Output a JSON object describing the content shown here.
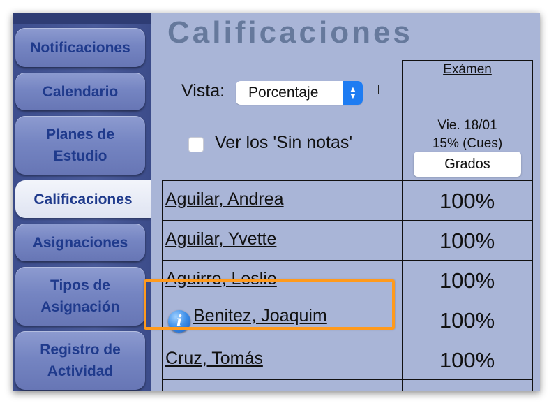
{
  "sidebar": {
    "items": [
      {
        "label": "Notificaciones",
        "active": false
      },
      {
        "label": "Calendario",
        "active": false
      },
      {
        "label": "Planes de\nEstudio",
        "active": false
      },
      {
        "label": "Calificaciones",
        "active": true
      },
      {
        "label": "Asignaciones",
        "active": false
      },
      {
        "label": "Tipos de\nAsignación",
        "active": false
      },
      {
        "label": "Registro de\nActividad",
        "active": false
      }
    ]
  },
  "main": {
    "title": "Calificaciones",
    "vista_label": "Vista:",
    "vista_value": "Porcentaje",
    "sin_notas_label": "Ver los 'Sin notas'",
    "sin_notas_checked": false
  },
  "column": {
    "title": "Exámen",
    "date": "Vie. 18/01",
    "weight": "15% (Cues)",
    "button_label": "Grados"
  },
  "students": [
    {
      "name": "Aguilar, Andrea",
      "grade": "100%"
    },
    {
      "name": "Aguilar, Yvette",
      "grade": "100%"
    },
    {
      "name": "Aguirre, Leslie",
      "grade": "100%"
    },
    {
      "name": "Benitez, Joaquim",
      "grade": "100%",
      "info_icon": true
    },
    {
      "name": "Cruz, Tomás",
      "grade": "100%"
    }
  ],
  "colors": {
    "highlight": "#ff9a1c",
    "sidebar_bg": "#4b5c9c",
    "main_bg": "#a9b5d7"
  }
}
